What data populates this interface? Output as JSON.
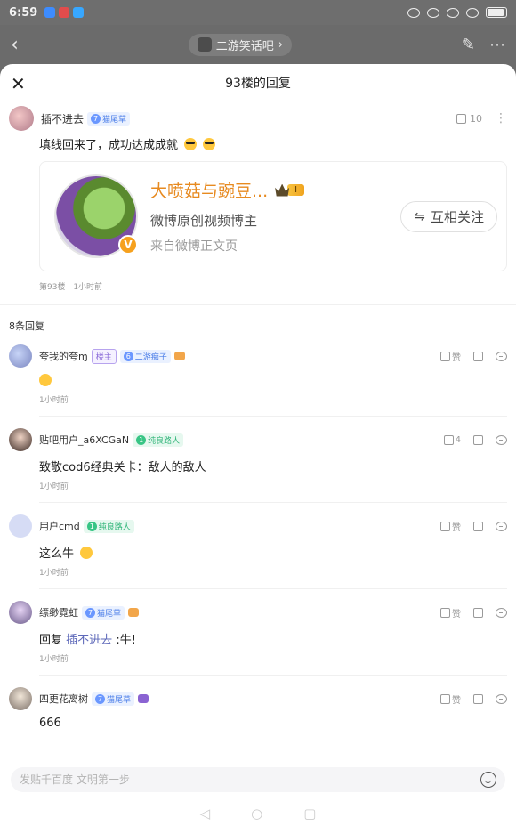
{
  "status_bar": {
    "time": "6:59"
  },
  "background_header": {
    "back_icon": "chevron-left-icon",
    "forum_name": "二游笑话吧",
    "forum_arrow": "›"
  },
  "sheet": {
    "title": "93楼的回复",
    "main_post": {
      "username": "插不进去",
      "level": "7",
      "badge": "猫尾草",
      "like_count": "10",
      "text": "填线回来了，成功达成成就",
      "share_card": {
        "title": "大喷菇与豌豆...",
        "level_tag": "I",
        "subtitle": "微博原创视频博主",
        "source": "来自微博正文页",
        "follow_label": "互相关注",
        "follow_icon": "⇋"
      },
      "floor": "第93楼",
      "time": "1小时前"
    },
    "reply_count_label": "8条回复",
    "replies": [
      {
        "username": "夸我的夸ɱ",
        "host_tag": "楼主",
        "level": "6",
        "badge": "二游痴子",
        "text": "",
        "time": "1小时前",
        "like": "赞",
        "emoji_reply": true
      },
      {
        "username": "贴吧用户_a6XCGaN",
        "level": "1",
        "badge": "纯良路人",
        "text": "致敬cod6经典关卡：敌人的敌人",
        "time": "1小时前",
        "like": "4"
      },
      {
        "username": "用户cmd",
        "level": "1",
        "badge": "纯良路人",
        "text": "这么牛",
        "time": "1小时前",
        "like": "赞"
      },
      {
        "username": "缥缈霓虹",
        "level": "7",
        "badge": "猫尾草",
        "text_prefix": "回复",
        "mention": "插不进去",
        "text_suffix": " :牛!",
        "time": "1小时前",
        "like": "赞"
      },
      {
        "username": "四更花离树",
        "level": "7",
        "badge": "猫尾草",
        "text": "666",
        "like": "赞"
      }
    ],
    "input_placeholder": "发贴千百度 文明第一步"
  },
  "colors": {
    "accent_orange": "#e78a20",
    "badge_blue": "#4a7de8",
    "badge_green": "#2fb478",
    "mention": "#5d68b9"
  }
}
